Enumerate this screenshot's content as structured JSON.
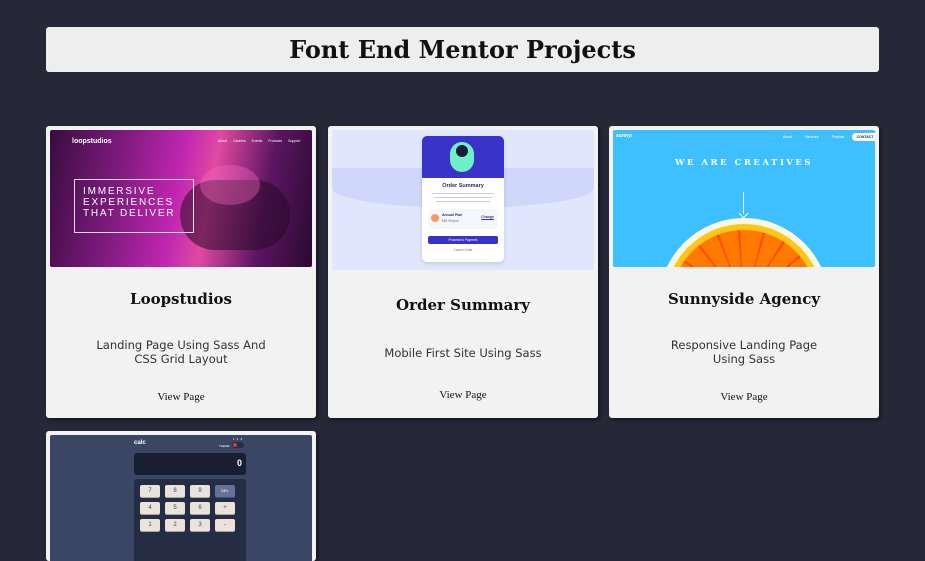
{
  "header": {
    "title": "Font End Mentor Projects"
  },
  "cards": [
    {
      "title": "Loopstudios",
      "description": "Landing Page Using Sass And CSS Grid Layout",
      "link": "View Page",
      "preview": {
        "logo": "loopstudios",
        "nav": [
          "About",
          "Careers",
          "Events",
          "Products",
          "Support"
        ],
        "headline": [
          "IMMERSIVE",
          "EXPERIENCES",
          "THAT DELIVER"
        ]
      }
    },
    {
      "title": "Order Summary",
      "description": "Mobile First Site Using Sass",
      "link": "View Page",
      "preview": {
        "heading": "Order Summary",
        "plan_name": "Annual Plan",
        "plan_price": "$59.99/year",
        "change_label": "Change",
        "button_label": "Proceed to Payment",
        "cancel_label": "Cancel Order"
      }
    },
    {
      "title": "Sunnyside Agency",
      "description": "Responsive Landing Page Using Sass",
      "link": "View Page",
      "preview": {
        "logo": "sunnyside",
        "nav": [
          "About",
          "Services",
          "Projects"
        ],
        "contact": "CONTACT",
        "headline": "WE ARE CREATIVES"
      }
    },
    {
      "title": "",
      "description": "",
      "link": "",
      "preview": {
        "logo": "calc",
        "theme_label": "THEME",
        "theme_numbers": [
          "1",
          "2",
          "3"
        ],
        "display": "0",
        "keys": [
          "7",
          "8",
          "9",
          "DEL",
          "4",
          "5",
          "6",
          "+",
          "1",
          "2",
          "3",
          "-"
        ]
      }
    }
  ]
}
